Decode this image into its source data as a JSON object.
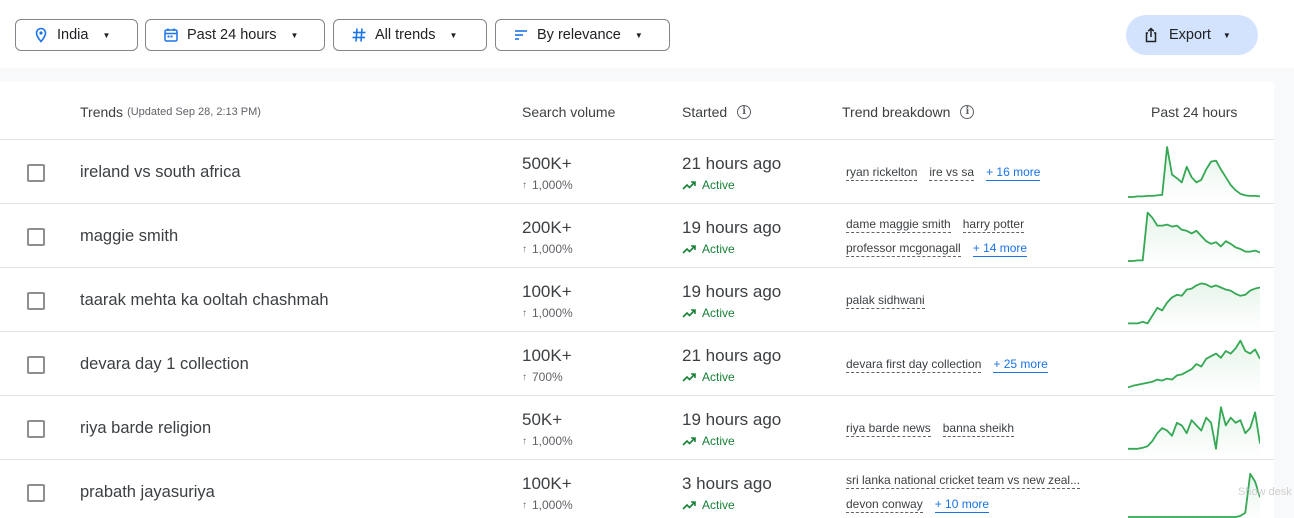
{
  "filters": {
    "location": "India",
    "time": "Past 24 hours",
    "category": "All trends",
    "sort": "By relevance"
  },
  "export_label": "Export",
  "header": {
    "trends": "Trends",
    "updated": "(Updated Sep 28, 2:13 PM)",
    "search_volume": "Search volume",
    "started": "Started",
    "breakdown": "Trend breakdown",
    "past": "Past 24 hours"
  },
  "colors": {
    "accent": "#1a73e8",
    "active_green": "#188038",
    "spark_green": "#34a853",
    "export_bg": "#d3e3fd"
  },
  "rows": [
    {
      "term": "ireland vs south africa",
      "volume": "500K+",
      "growth": "1,000%",
      "started": "21 hours ago",
      "status": "Active",
      "breakdown": [
        [
          "ryan rickelton",
          "ire vs sa"
        ]
      ],
      "more": "+ 16 more",
      "more_line": 0,
      "trend": [
        2,
        2,
        3,
        3,
        4,
        4,
        5,
        6,
        98,
        45,
        38,
        30,
        60,
        40,
        30,
        35,
        55,
        70,
        72,
        55,
        40,
        25,
        15,
        8,
        5,
        4,
        4,
        3
      ]
    },
    {
      "term": "maggie smith",
      "volume": "200K+",
      "growth": "1,000%",
      "started": "19 hours ago",
      "status": "Active",
      "breakdown": [
        [
          "dame maggie smith",
          "harry potter"
        ],
        [
          "professor mcgonagall"
        ]
      ],
      "more": "+ 14 more",
      "more_line": 1,
      "trend": [
        2,
        2,
        3,
        3,
        95,
        85,
        70,
        70,
        72,
        68,
        70,
        62,
        60,
        55,
        60,
        50,
        40,
        35,
        38,
        30,
        40,
        35,
        28,
        25,
        20,
        20,
        22,
        18
      ]
    },
    {
      "term": "taarak mehta ka ooltah chashmah",
      "volume": "100K+",
      "growth": "1,000%",
      "started": "19 hours ago",
      "status": "Active",
      "breakdown": [
        [
          "palak sidhwani"
        ]
      ],
      "more": "",
      "more_line": 0,
      "trend": [
        5,
        5,
        5,
        8,
        5,
        20,
        35,
        30,
        45,
        55,
        60,
        58,
        70,
        72,
        78,
        82,
        80,
        75,
        78,
        74,
        70,
        68,
        62,
        58,
        60,
        68,
        72,
        74
      ]
    },
    {
      "term": "devara day 1 collection",
      "volume": "100K+",
      "growth": "700%",
      "started": "21 hours ago",
      "status": "Active",
      "breakdown": [
        [
          "devara first day collection"
        ]
      ],
      "more": "+ 25 more",
      "more_line": 0,
      "trend": [
        5,
        8,
        10,
        12,
        14,
        16,
        20,
        18,
        22,
        20,
        28,
        30,
        35,
        40,
        50,
        45,
        60,
        65,
        70,
        62,
        75,
        70,
        80,
        95,
        75,
        70,
        78,
        60
      ]
    },
    {
      "term": "riya barde religion",
      "volume": "50K+",
      "growth": "1,000%",
      "started": "19 hours ago",
      "status": "Active",
      "breakdown": [
        [
          "riya barde news",
          "banna sheikh"
        ]
      ],
      "more": "",
      "more_line": 0,
      "trend": [
        10,
        10,
        10,
        12,
        15,
        25,
        40,
        50,
        45,
        35,
        60,
        55,
        40,
        65,
        55,
        45,
        70,
        60,
        10,
        90,
        55,
        70,
        60,
        65,
        40,
        50,
        80,
        20
      ]
    },
    {
      "term": "prabath jayasuriya",
      "volume": "100K+",
      "growth": "1,000%",
      "started": "3 hours ago",
      "status": "Active",
      "breakdown": [
        [
          "sri lanka national cricket team vs new zeal..."
        ],
        [
          "devon conway"
        ]
      ],
      "more": "+ 10 more",
      "more_line": 1,
      "trend": [
        2,
        2,
        2,
        2,
        2,
        2,
        2,
        2,
        2,
        2,
        2,
        2,
        2,
        2,
        2,
        2,
        2,
        2,
        2,
        2,
        2,
        2,
        2,
        4,
        10,
        85,
        70,
        40
      ]
    }
  ],
  "watermark": "Show desk"
}
